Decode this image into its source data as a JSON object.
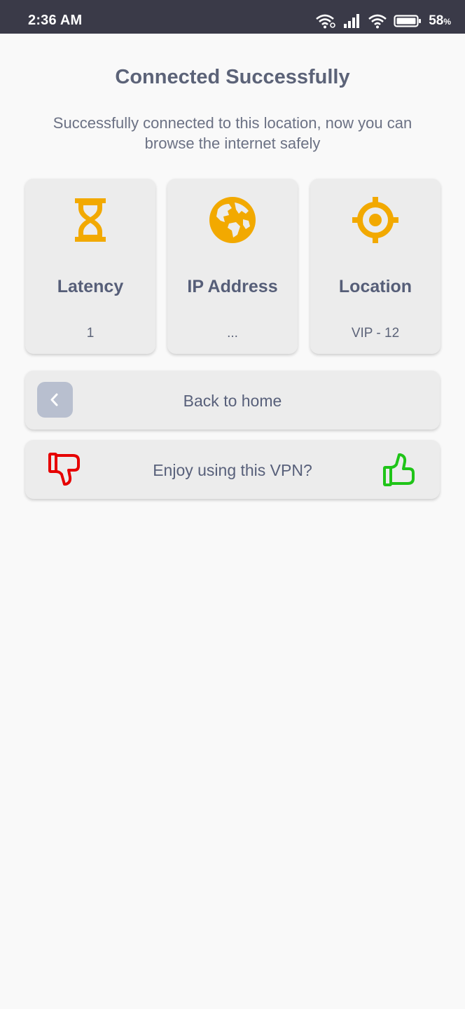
{
  "status_bar": {
    "time": "2:36 AM",
    "battery_percent": "58",
    "battery_unit": "%",
    "icons": [
      "hotspot-wifi-icon",
      "cell-signal-icon",
      "wifi-icon",
      "battery-icon"
    ]
  },
  "header": {
    "title": "Connected Successfully",
    "subtitle": "Successfully connected to this location, now you can browse the internet safely"
  },
  "stats": [
    {
      "icon": "hourglass-icon",
      "label": "Latency",
      "value": "1"
    },
    {
      "icon": "globe-icon",
      "label": "IP Address",
      "value": "..."
    },
    {
      "icon": "target-icon",
      "label": "Location",
      "value": "VIP - 12"
    }
  ],
  "actions": {
    "back_label": "Back to home",
    "back_icon": "chevron-left-icon",
    "rate_label": "Enjoy using this VPN?",
    "dislike_icon": "thumbs-down-icon",
    "like_icon": "thumbs-up-icon"
  },
  "colors": {
    "status_bar": "#3a3a48",
    "accent_icon": "#f2a900",
    "dislike": "#e60000",
    "like": "#1fc418",
    "card_bg": "#ececec",
    "back_chip": "#b8bfcf"
  }
}
